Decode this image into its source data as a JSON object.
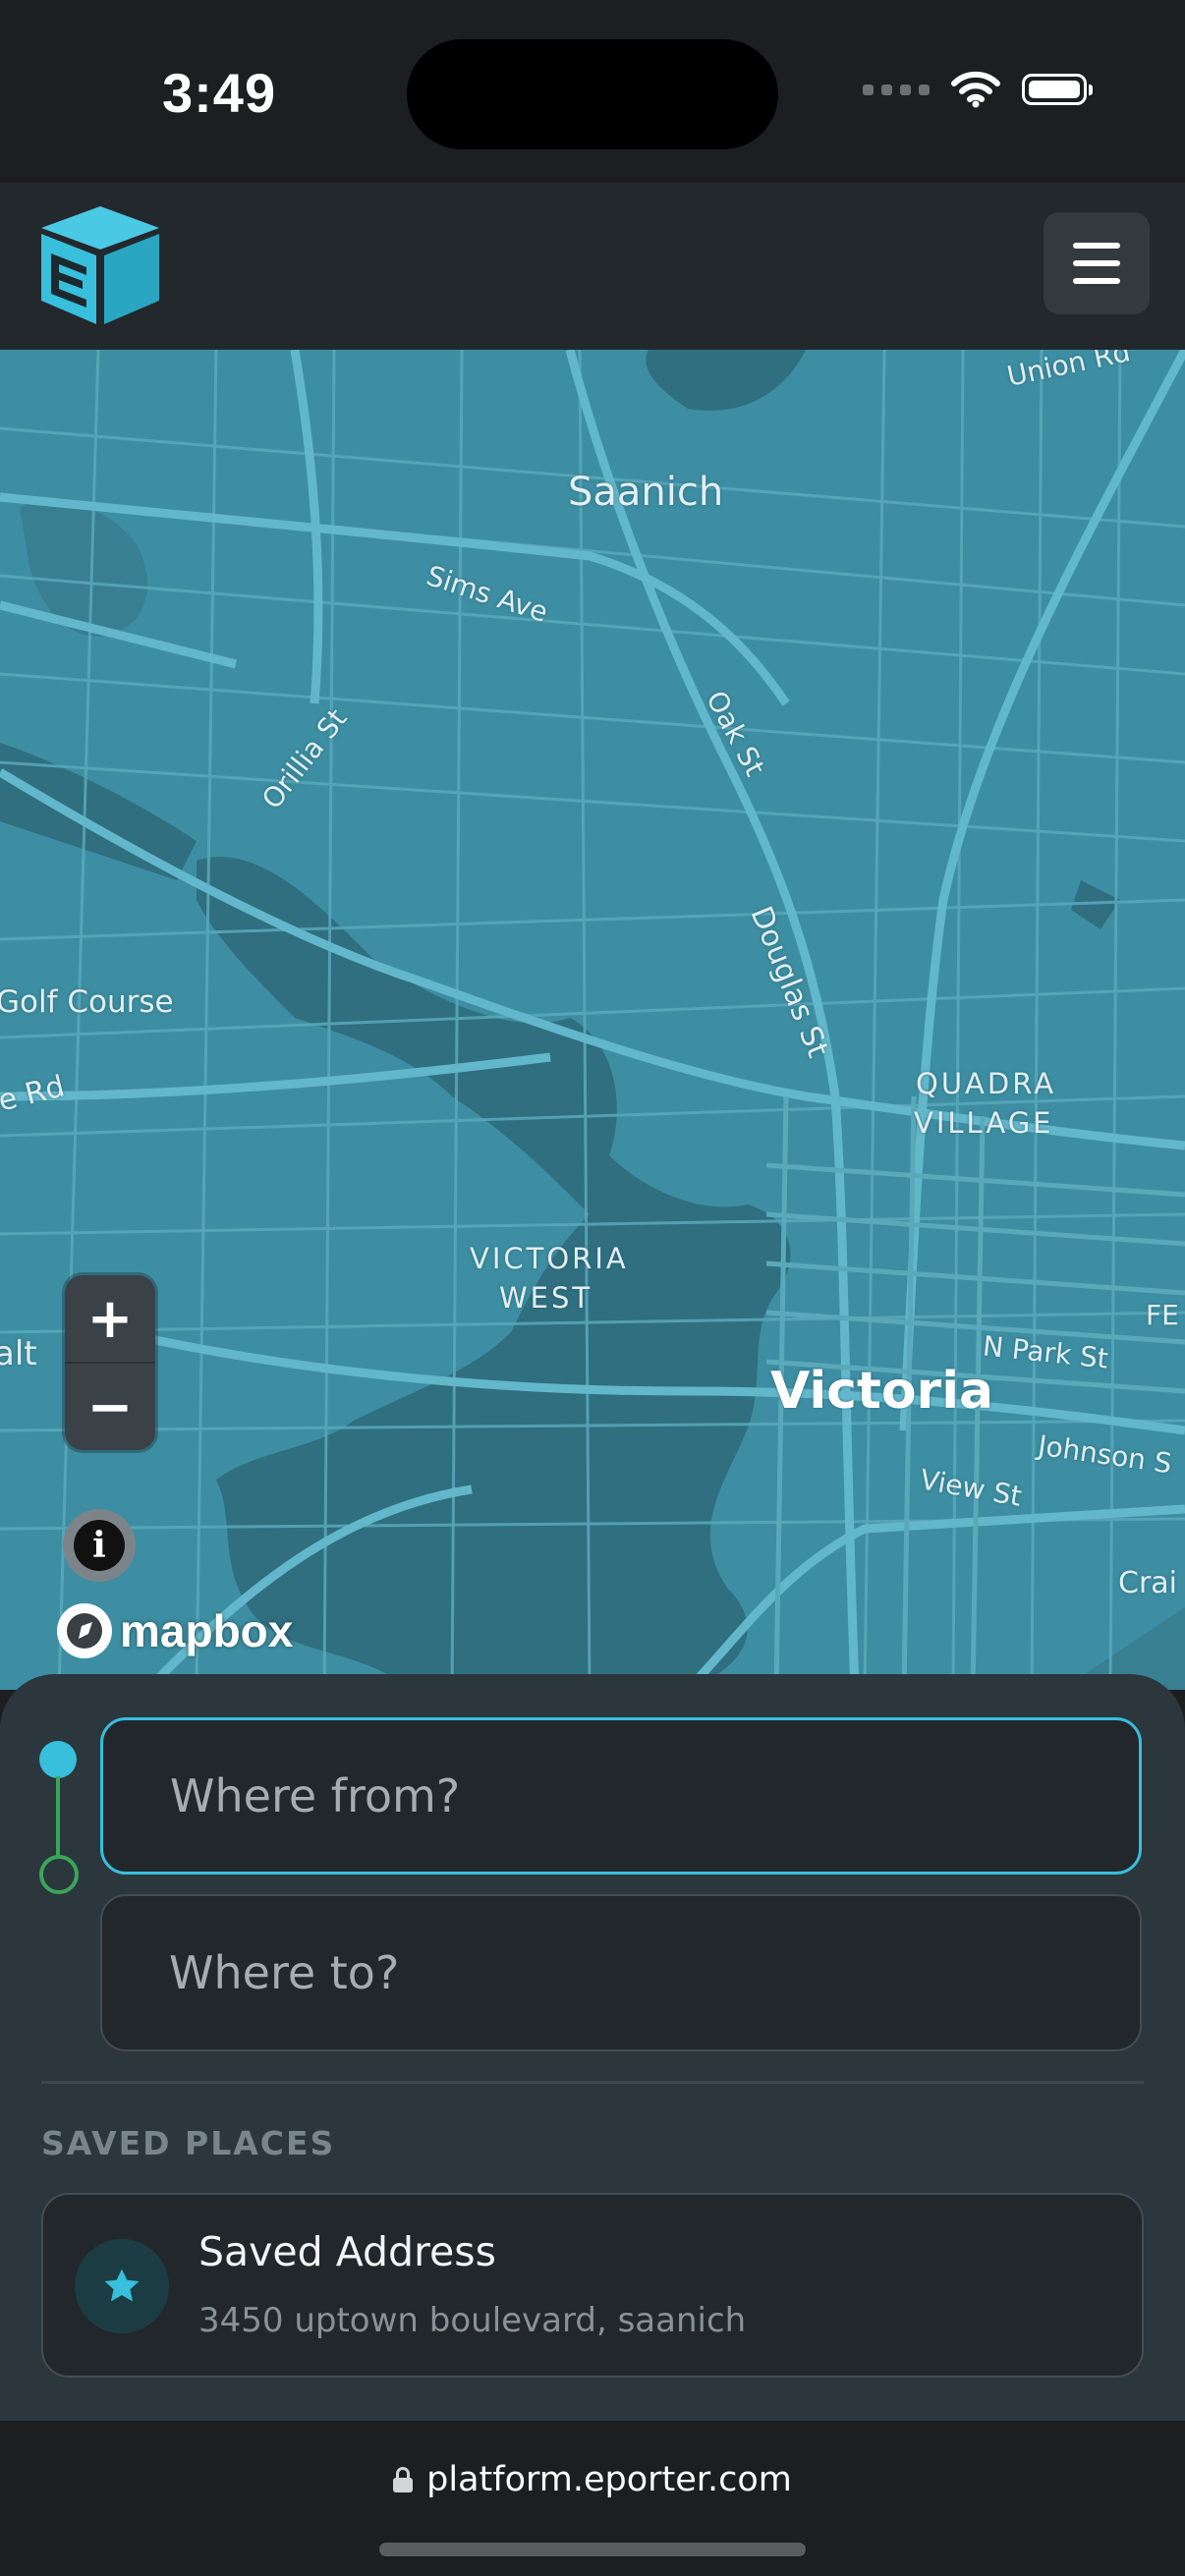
{
  "status_bar": {
    "time": "3:49"
  },
  "header": {
    "logo_icon": "box-logo-icon",
    "menu_icon": "hamburger-icon"
  },
  "map": {
    "labels": {
      "union": "Union Rd",
      "saanich": "Saanich",
      "sims": "Sims Ave",
      "orillia": "Orillia St",
      "oak": "Oak St",
      "douglas": "Douglas St",
      "golf": "Golf Course",
      "e_rd": "e Rd",
      "quadra": "QUADRA",
      "village": "VILLAGE",
      "vic_west_1": "VICTORIA",
      "vic_west_2": "WEST",
      "victoria": "Victoria",
      "n_park": "N Park St",
      "johnson": "Johnson S",
      "view": "View St",
      "crai": "Crai",
      "fe": "FE",
      "alt": "alt"
    },
    "zoom_in": "+",
    "zoom_out": "−",
    "info": "i",
    "attribution": "mapbox"
  },
  "trip": {
    "from_placeholder": "Where from?",
    "to_placeholder": "Where to?"
  },
  "saved_places": {
    "title": "SAVED PLACES",
    "items": [
      {
        "name": "Saved Address",
        "address": "3450 uptown boulevard, saanich",
        "icon": "star-icon"
      }
    ]
  },
  "browser": {
    "url": "platform.eporter.com"
  },
  "colors": {
    "accent": "#37bfdc",
    "route_end": "#3aa657",
    "map_land": "#3d8ea2",
    "map_water": "#2f6f80"
  }
}
